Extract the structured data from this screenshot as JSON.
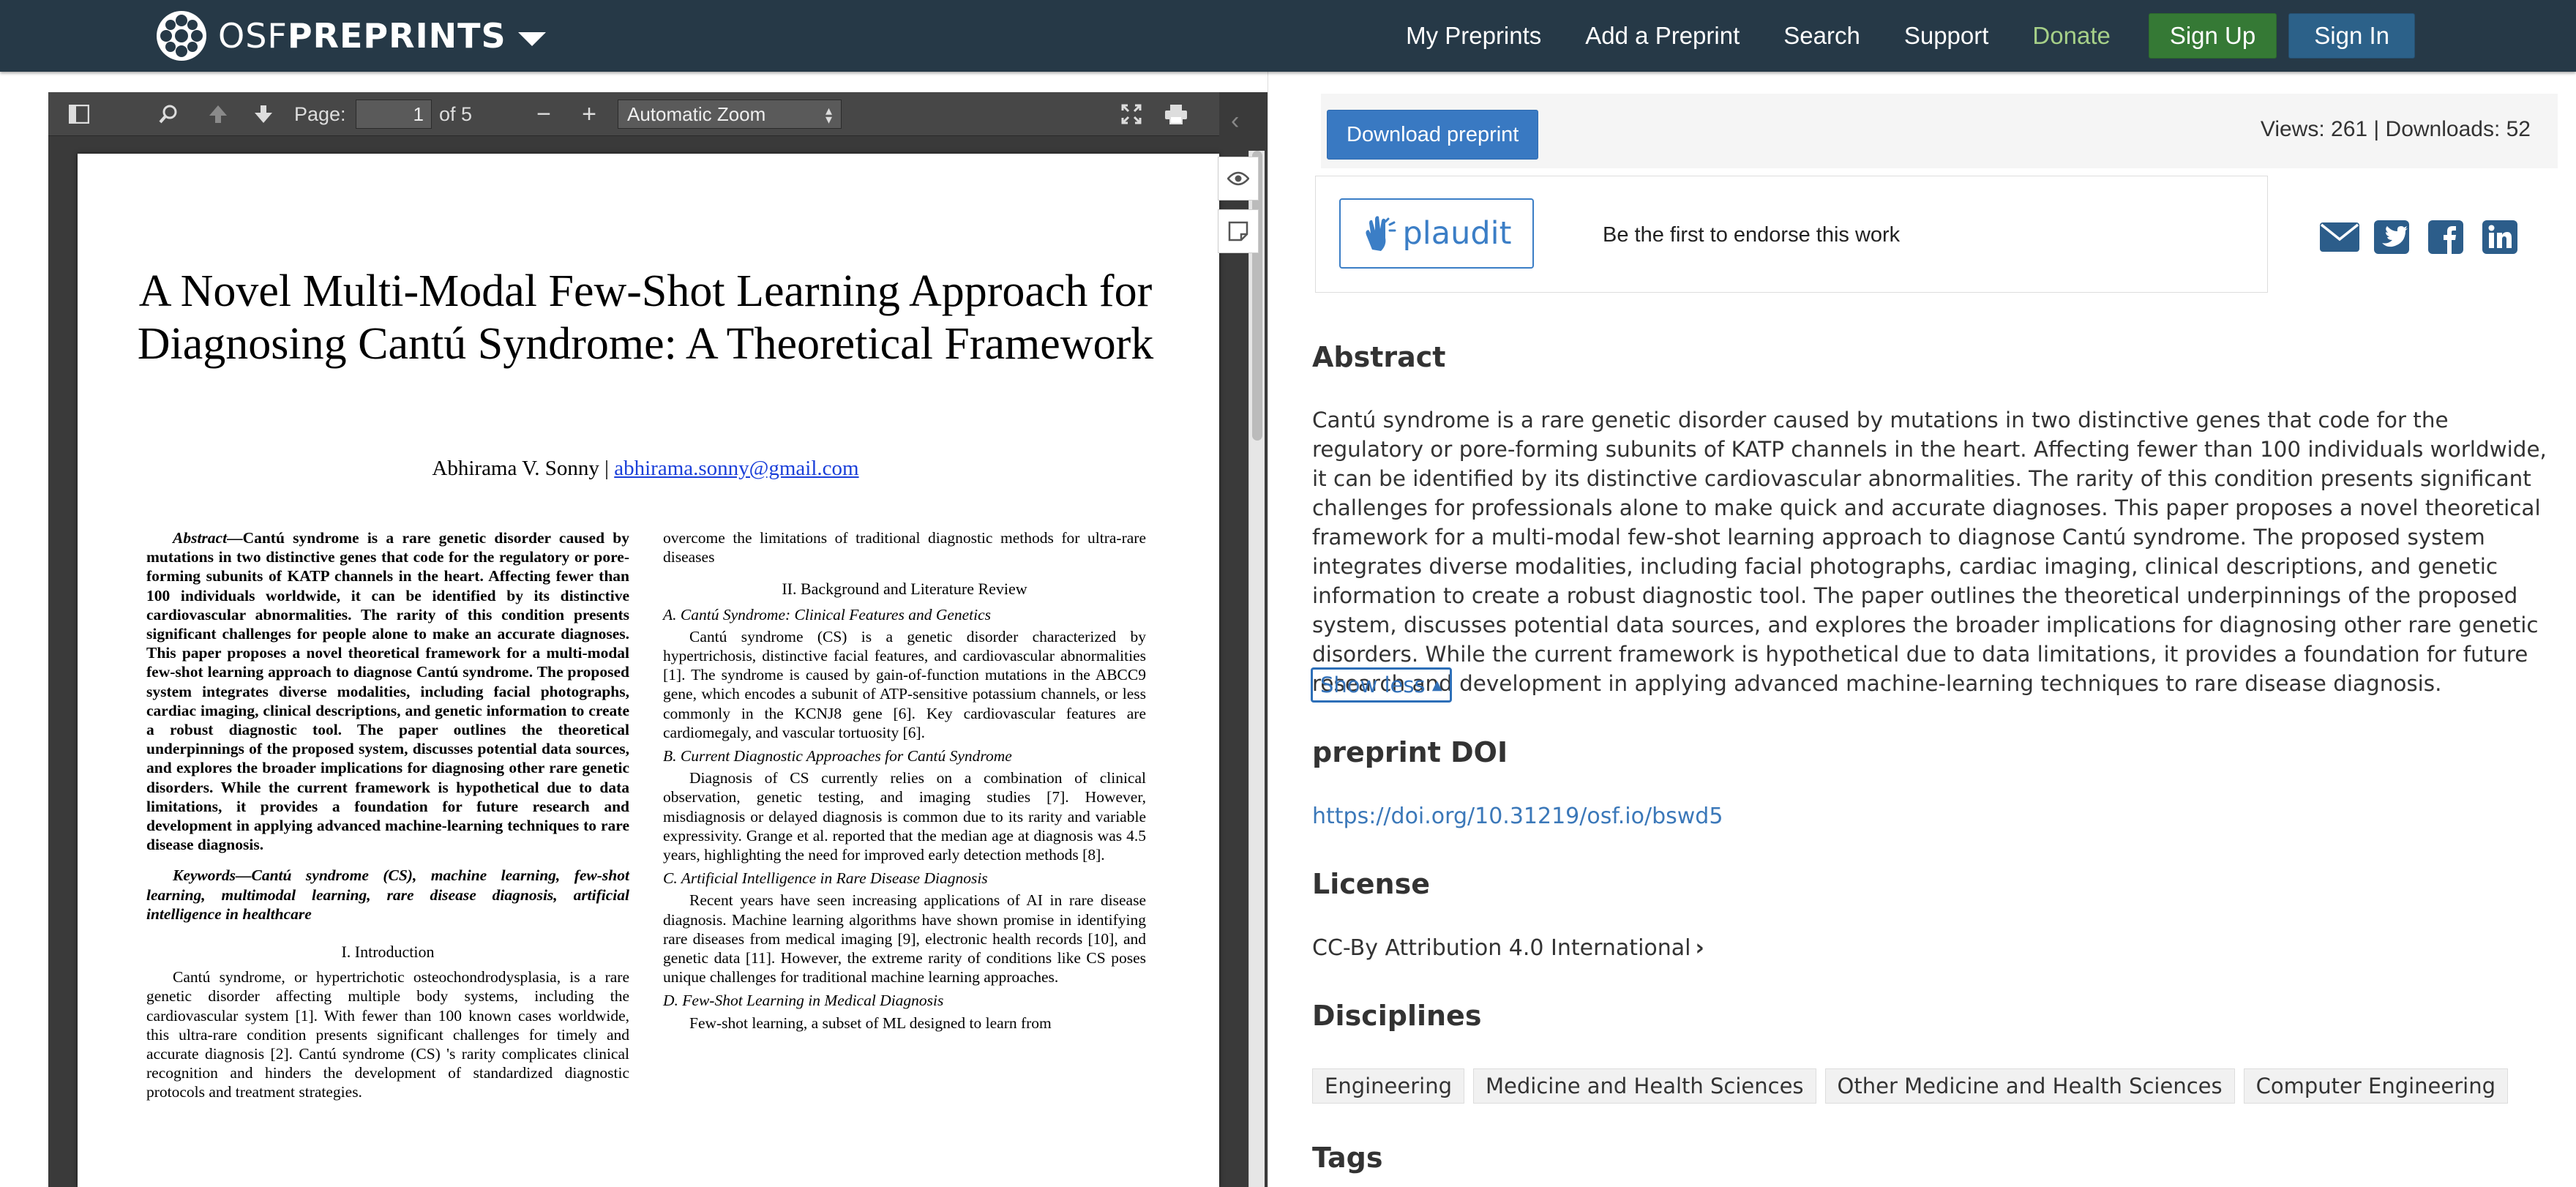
{
  "nav": {
    "brand_osf": "OSF",
    "brand_preprints": "PREPRINTS",
    "links": [
      "My Preprints",
      "Add a Preprint",
      "Search",
      "Support"
    ],
    "donate": "Donate",
    "sign_up": "Sign Up",
    "sign_in": "Sign In"
  },
  "viewer": {
    "page_label": "Page:",
    "page_value": "1",
    "page_of": "of 5",
    "zoom": "Automatic Zoom"
  },
  "paper": {
    "title": "A Novel Multi-Modal Few-Shot Learning Approach for Diagnosing Cantú Syndrome: A Theoretical Framework",
    "author": "Abhirama V. Sonny | ",
    "email": "abhirama.sonny@gmail.com",
    "abstract_label": "Abstract",
    "abstract_body": "—Cantú syndrome is a rare genetic disorder caused by mutations in two distinctive genes that code for the regulatory or pore-forming subunits of KATP channels in the heart. Affecting fewer than 100 individuals worldwide, it can be identified by its distinctive cardiovascular abnormalities. The rarity of this condition presents significant challenges for people alone to make an accurate diagnoses. This paper proposes a novel theoretical framework for a multi-modal few-shot learning approach to diagnose Cantú syndrome. The proposed system integrates diverse modalities, including facial photographs, cardiac imaging, clinical descriptions, and genetic information to create a robust diagnostic tool. The paper outlines the theoretical underpinnings of the proposed system, discusses potential data sources, and explores the broader implications for diagnosing other rare genetic disorders. While the current framework is hypothetical due to data limitations, it provides a foundation for future research and development in applying advanced machine-learning techniques to rare disease diagnosis.",
    "keywords": "Keywords—Cantú syndrome (CS), machine learning, few-shot learning, multimodal learning, rare disease diagnosis, artificial intelligence in healthcare",
    "sec1": "I.      Introduction",
    "sec1_body": "Cantú syndrome, or hypertrichotic osteochondrodysplasia, is a rare genetic disorder affecting multiple body systems, including the cardiovascular system [1]. With fewer than 100 known cases worldwide, this ultra-rare condition presents significant challenges for timely and accurate diagnosis [2]. Cantú syndrome (CS) 's rarity complicates clinical recognition and hinders the development of standardized diagnostic protocols and treatment strategies.",
    "right_intro": "overcome the limitations of traditional diagnostic methods for ultra-rare diseases",
    "sec2": "II.      Background and Literature Review",
    "subA": "A.  Cantú Syndrome: Clinical Features and Genetics",
    "subA_body": "Cantú syndrome (CS) is a genetic disorder characterized by hypertrichosis, distinctive facial features, and cardiovascular abnormalities [1]. The syndrome is caused by gain-of-function mutations in the ABCC9 gene, which encodes a subunit of ATP-sensitive potassium channels, or less commonly in the KCNJ8 gene [6]. Key cardiovascular features are cardiomegaly, and vascular tortuosity [6].",
    "subB": "B.  Current Diagnostic Approaches for Cantú Syndrome",
    "subB_body": "Diagnosis of CS currently relies on a combination of clinical observation, genetic testing, and imaging studies [7]. However, misdiagnosis or delayed diagnosis is common due to its rarity and variable expressivity. Grange et al. reported that the median age at diagnosis was 4.5 years, highlighting the need for improved early detection methods [8].",
    "subC": "C.  Artificial Intelligence in Rare Disease Diagnosis",
    "subC_body": "Recent years have seen increasing applications of AI in rare disease diagnosis. Machine learning algorithms have shown promise in identifying rare diseases from medical imaging [9], electronic health records [10], and genetic data [11]. However, the extreme rarity of conditions like CS poses unique challenges for traditional machine learning approaches.",
    "subD": "D.  Few-Shot Learning in Medical Diagnosis",
    "subD_body": "Few-shot learning, a subset of ML designed to learn from"
  },
  "panel": {
    "download": "Download preprint",
    "stats": "Views: 261 | Downloads: 52",
    "plaudit": "plaudit",
    "endorse": "Be the first to endorse this work",
    "abstract_heading": "Abstract",
    "abstract": "Cantú syndrome is a rare genetic disorder caused by mutations in two distinctive genes that code for the regulatory or pore-forming subunits of KATP channels in the heart. Affecting fewer than 100 individuals worldwide, it can be identified by its distinctive cardiovascular abnormalities. The rarity of this condition presents significant challenges for professionals alone to make quick and accurate diagnoses. This paper proposes a novel theoretical framework for a multi-modal few-shot learning approach to diagnose Cantú syndrome. The proposed system integrates diverse modalities, including facial photographs, cardiac imaging, clinical descriptions, and genetic information to create a robust diagnostic tool. The paper outlines the theoretical underpinnings of the proposed system, discusses potential data sources, and explores the broader implications for diagnosing other rare genetic disorders. While the current framework is hypothetical due to data limitations, it provides a foundation for future research and development in applying advanced machine-learning techniques to rare disease diagnosis.",
    "show_less": "Show less",
    "doi_heading": "preprint DOI",
    "doi": "https://doi.org/10.31219/osf.io/bswd5",
    "license_heading": "License",
    "license": "CC-By Attribution 4.0 International",
    "disciplines_heading": "Disciplines",
    "disciplines": [
      "Engineering",
      "Medicine and Health Sciences",
      "Other Medicine and Health Sciences",
      "Computer Engineering"
    ],
    "tags_heading": "Tags"
  },
  "colors": {
    "nav_bg": "#263947",
    "donate": "#a6d088",
    "signup": "#357935",
    "signin": "#2c6189",
    "download": "#3979c2",
    "link": "#3b78b9"
  },
  "icons": {
    "brand": "osf-flower-logo",
    "viewer": [
      "sidebar-toggle-icon",
      "search-icon",
      "previous-page-icon",
      "next-page-icon",
      "zoom-out-icon",
      "zoom-in-icon",
      "fullscreen-icon",
      "print-icon",
      "collapse-left-icon",
      "eye-icon",
      "note-icon"
    ],
    "share": [
      "email-icon",
      "twitter-icon",
      "facebook-icon",
      "linkedin-icon"
    ]
  }
}
